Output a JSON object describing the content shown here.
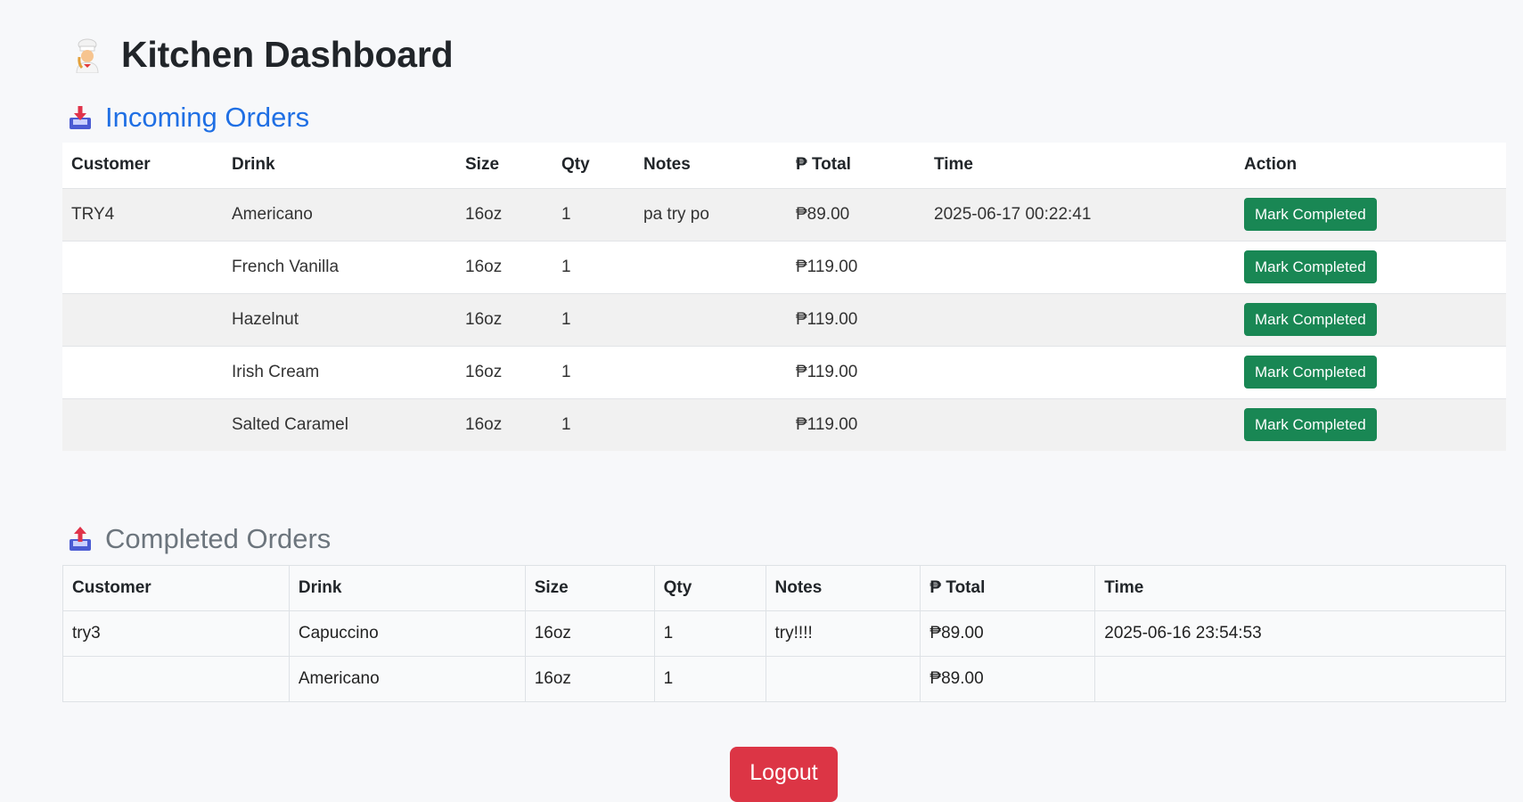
{
  "header": {
    "title": "Kitchen Dashboard",
    "icon": "chef-icon"
  },
  "incoming": {
    "heading": "Incoming Orders",
    "icon": "inbox-tray-icon",
    "accent": "#1f6fe4",
    "columns": [
      "Customer",
      "Drink",
      "Size",
      "Qty",
      "Notes",
      "₱ Total",
      "Time",
      "Action"
    ],
    "rows": [
      {
        "customer": "TRY4",
        "drink": "Americano",
        "size": "16oz",
        "qty": "1",
        "notes": "pa try po",
        "total": "₱89.00",
        "time": "2025-06-17 00:22:41",
        "action": "Mark Completed"
      },
      {
        "customer": "",
        "drink": "French Vanilla",
        "size": "16oz",
        "qty": "1",
        "notes": "",
        "total": "₱119.00",
        "time": "",
        "action": "Mark Completed"
      },
      {
        "customer": "",
        "drink": "Hazelnut",
        "size": "16oz",
        "qty": "1",
        "notes": "",
        "total": "₱119.00",
        "time": "",
        "action": "Mark Completed"
      },
      {
        "customer": "",
        "drink": "Irish Cream",
        "size": "16oz",
        "qty": "1",
        "notes": "",
        "total": "₱119.00",
        "time": "",
        "action": "Mark Completed"
      },
      {
        "customer": "",
        "drink": "Salted Caramel",
        "size": "16oz",
        "qty": "1",
        "notes": "",
        "total": "₱119.00",
        "time": "",
        "action": "Mark Completed"
      }
    ]
  },
  "completed": {
    "heading": "Completed Orders",
    "icon": "outbox-tray-icon",
    "columns": [
      "Customer",
      "Drink",
      "Size",
      "Qty",
      "Notes",
      "₱ Total",
      "Time"
    ],
    "rows": [
      {
        "customer": "try3",
        "drink": "Capuccino",
        "size": "16oz",
        "qty": "1",
        "notes": "try!!!!",
        "total": "₱89.00",
        "time": "2025-06-16 23:54:53"
      },
      {
        "customer": "",
        "drink": "Americano",
        "size": "16oz",
        "qty": "1",
        "notes": "",
        "total": "₱89.00",
        "time": ""
      }
    ]
  },
  "logout_label": "Logout",
  "colors": {
    "success": "#198754",
    "danger": "#dc3545",
    "primary": "#1f6fe4",
    "muted": "#6c757d"
  }
}
